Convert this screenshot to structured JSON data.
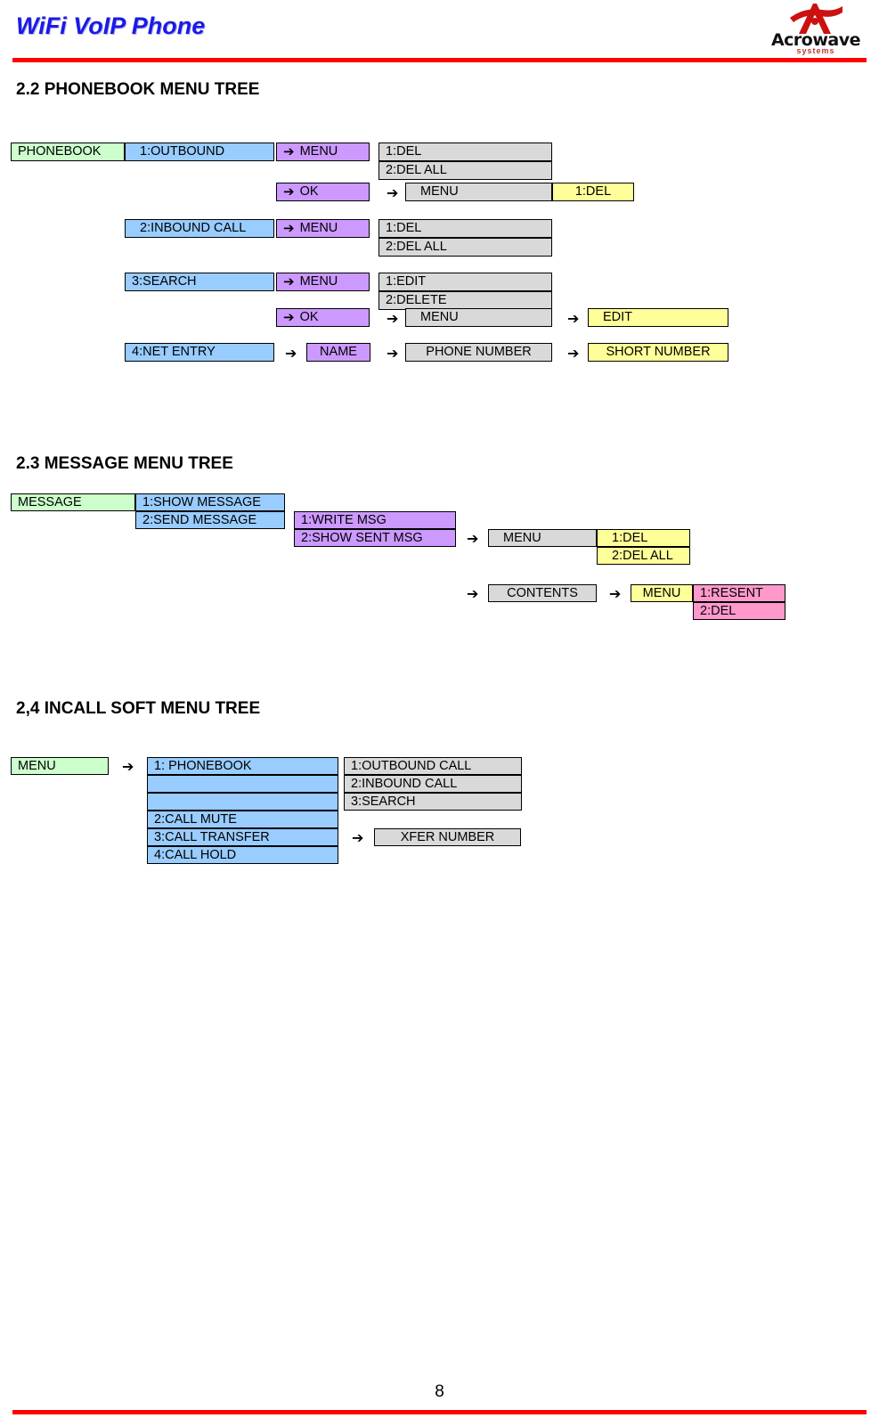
{
  "header": {
    "title": "WiFi VoIP Phone",
    "logo_name": "Acrowave",
    "logo_sub": "systems",
    "logo_mark_icon": "acrowave-a-logo-icon"
  },
  "footer": {
    "page_number": "8"
  },
  "arrow_glyph": "➔",
  "sections": [
    {
      "id": "phonebook",
      "heading": "2.2 PHONEBOOK MENU TREE"
    },
    {
      "id": "message",
      "heading": "2.3 MESSAGE MENU TREE"
    },
    {
      "id": "incall",
      "heading": "2,4 INCALL SOFT MENU TREE"
    }
  ],
  "phonebook_tree": {
    "root": "PHONEBOOK",
    "outbound": {
      "label": "1:OUTBOUND",
      "menu": "MENU",
      "items": [
        "1:DEL",
        "2:DEL ALL"
      ],
      "ok": "OK",
      "ok_menu": "MENU",
      "ok_menu_item": "1:DEL"
    },
    "inbound": {
      "label": "2:INBOUND CALL",
      "menu": "MENU",
      "items": [
        "1:DEL",
        "2:DEL ALL"
      ]
    },
    "search": {
      "label": "3:SEARCH",
      "menu": "MENU",
      "items": [
        "1:EDIT",
        "2:DELETE"
      ],
      "ok": "OK",
      "ok_menu": "MENU",
      "ok_menu_item": "EDIT"
    },
    "net_entry": {
      "label": "4:NET ENTRY",
      "name": "NAME",
      "phone_number": "PHONE NUMBER",
      "short_number": "SHORT NUMBER"
    }
  },
  "message_tree": {
    "root": "MESSAGE",
    "show_message": "1:SHOW MESSAGE",
    "send_message": "2:SEND MESSAGE",
    "write_msg": "1:WRITE MSG",
    "show_sent_msg": "2:SHOW SENT MSG",
    "sent_menu": "MENU",
    "sent_menu_items": [
      "1:DEL",
      "2:DEL ALL"
    ],
    "contents": "CONTENTS",
    "contents_menu": "MENU",
    "contents_menu_items": [
      "1:RESENT",
      "2:DEL"
    ]
  },
  "incall_tree": {
    "root": "MENU",
    "phonebook": "1: PHONEBOOK",
    "phonebook_subitems": [
      "1:OUTBOUND CALL",
      "2:INBOUND CALL",
      "3:SEARCH"
    ],
    "call_mute": "2:CALL MUTE",
    "call_transfer": "3:CALL TRANSFER",
    "call_hold": "4:CALL HOLD",
    "xfer_number": "XFER NUMBER"
  },
  "colors": {
    "accent_red": "#ff0000",
    "title_blue": "#1a1ae6",
    "green": "#ccffcc",
    "blue": "#99ccff",
    "purple": "#cc99ff",
    "gray": "#d9d9d9",
    "yellow": "#ffff99",
    "pink": "#ff99cc"
  }
}
